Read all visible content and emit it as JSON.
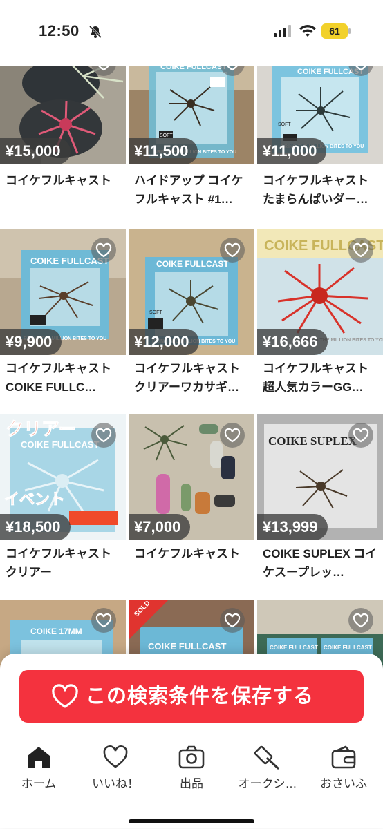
{
  "status_bar": {
    "time": "12:50",
    "battery": "61"
  },
  "items": [
    {
      "price": "¥15,000",
      "title": "コイケフルキャスト"
    },
    {
      "price": "¥11,500",
      "title": "ハイドアップ コイケフルキャスト #1…"
    },
    {
      "price": "¥11,000",
      "title": "コイケフルキャスト たまらんばいダー…"
    },
    {
      "price": "¥9,900",
      "title": "コイケフルキャスト COIKE FULLC…"
    },
    {
      "price": "¥12,000",
      "title": "コイケフルキャスト クリアーワカサギ…"
    },
    {
      "price": "¥16,666",
      "title": "コイケフルキャスト 超人気カラーGG…"
    },
    {
      "price": "¥18,500",
      "title": "コイケフルキャスト クリアー"
    },
    {
      "price": "¥7,000",
      "title": "コイケフルキャスト"
    },
    {
      "price": "¥13,999",
      "title": "COIKE SUPLEX コイケスープレッ…"
    },
    {
      "price": "",
      "title": ""
    },
    {
      "price": "",
      "title": "",
      "sold": "SOLD"
    },
    {
      "price": "",
      "title": ""
    }
  ],
  "image_text": {
    "box1": "COIKE FULLCAST",
    "box_tag": "SOFT",
    "bring": "BRING THE MILLION BITES TO YOU",
    "box4": "COIKE FULLCAST",
    "box5": "COIKE FULLCAST",
    "box6": "COIKE FULLCAST",
    "box7_top": "クリアー",
    "box7_mid": "COIKE FULLCAST",
    "box7_bot": "イベント",
    "box9": "COIKE SUPLEX",
    "box10": "COIKE 17MM",
    "box11": "COIKE FULLCAST",
    "box12a": "COIKE FULLCAST",
    "box12b": "COIKE FULLCAST"
  },
  "save_button": {
    "label": "この検索条件を保存する"
  },
  "tabs": [
    {
      "label": "ホーム",
      "icon": "home-icon"
    },
    {
      "label": "いいね！",
      "icon": "heart-icon"
    },
    {
      "label": "出品",
      "icon": "camera-icon"
    },
    {
      "label": "オークシ…",
      "icon": "auction-hammer-icon"
    },
    {
      "label": "おさいふ",
      "icon": "wallet-icon"
    }
  ],
  "colors": {
    "accent": "#f4323e",
    "price_bg": "#3c3c3c",
    "battery": "#f2d12b"
  }
}
